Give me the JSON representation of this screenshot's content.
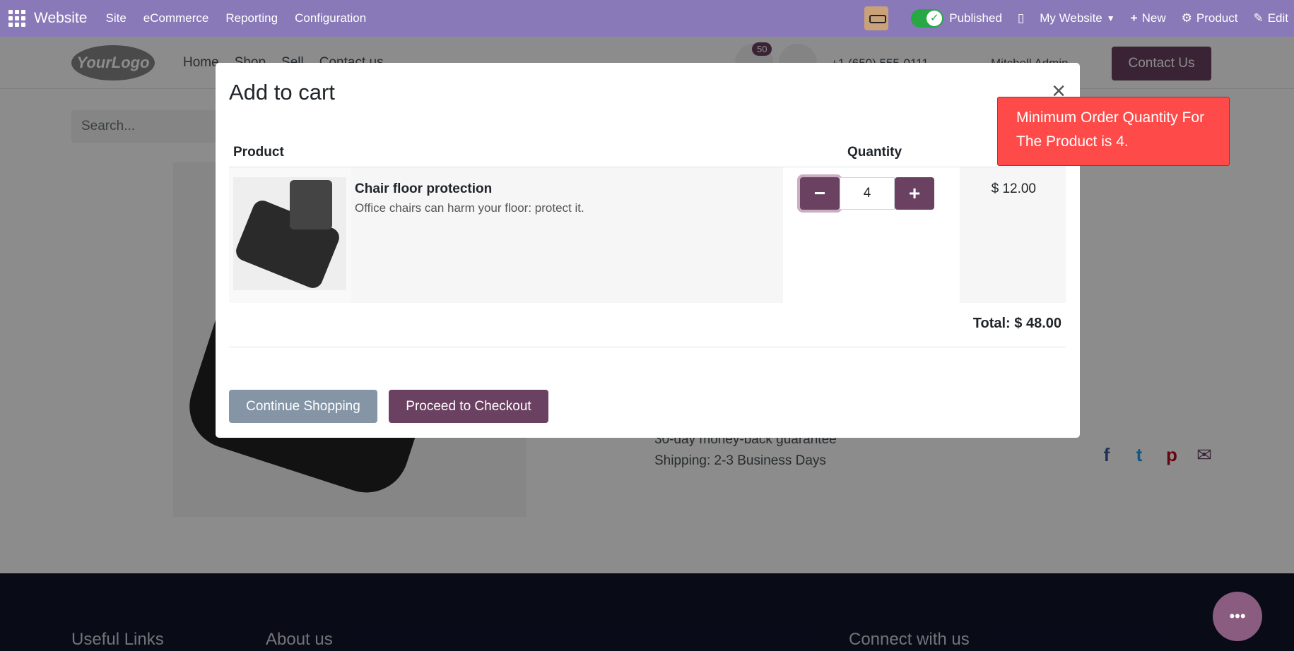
{
  "adminbar": {
    "brand": "Website",
    "menus": [
      "Site",
      "eCommerce",
      "Reporting",
      "Configuration"
    ],
    "published_label": "Published",
    "website_label": "My Website",
    "new_label": "New",
    "product_label": "Product",
    "edit_label": "Edit"
  },
  "siteheader": {
    "logo_text": "YourLogo",
    "nav": [
      "Home",
      "Shop",
      "Sell",
      "Contact us"
    ],
    "cart_count": "50",
    "phone": "+1 (650) 555-0111",
    "user": "Mitchell Admin",
    "contact_button": "Contact Us"
  },
  "page": {
    "search_placeholder": "Search...",
    "guarantee": "30-day money-back guarantee",
    "shipping": "Shipping: 2-3 Business Days"
  },
  "footer": {
    "useful_links": "Useful Links",
    "about_us": "About us",
    "connect": "Connect with us"
  },
  "modal": {
    "title": "Add to cart",
    "close": "×",
    "headers": {
      "product": "Product",
      "quantity": "Quantity"
    },
    "item": {
      "name": "Chair floor protection",
      "description": "Office chairs can harm your floor: protect it.",
      "quantity": "4",
      "price": "$ 12.00"
    },
    "total": "Total: $ 48.00",
    "continue_label": "Continue Shopping",
    "checkout_label": "Proceed to Checkout"
  },
  "toast": {
    "message": "Minimum Order Quantity For The Product is 4."
  },
  "colors": {
    "admin_bar": "#8a79b8",
    "primary": "#6b4162",
    "toast": "#fe4a49",
    "secondary_button": "#8595a6"
  },
  "icons": {
    "apps": "apps-grid-icon",
    "published": "check-icon",
    "mobile": "mobile-icon",
    "new": "plus-icon",
    "product": "gear-icon",
    "edit": "pencil-icon",
    "chat": "chat-icon"
  }
}
